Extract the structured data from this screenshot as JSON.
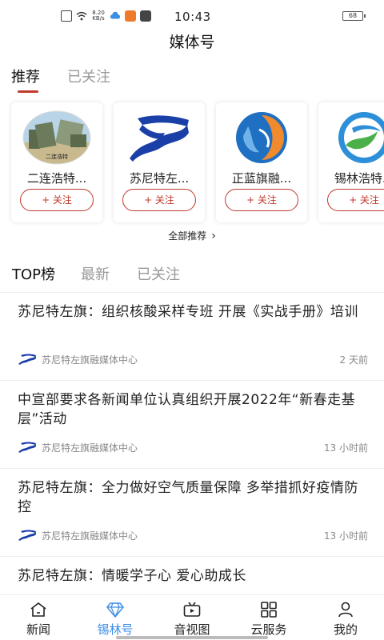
{
  "status_bar": {
    "time": "10:43",
    "battery": "68",
    "net_speed_top": "8.20",
    "net_speed_bottom": "KB/s"
  },
  "page_title": "媒体号",
  "top_tabs": [
    {
      "label": "推荐",
      "active": true
    },
    {
      "label": "已关注",
      "active": false
    }
  ],
  "media_cards": [
    {
      "name": "二连浩特...",
      "follow_label": "+ 关注",
      "logo": "erlianhaote-logo"
    },
    {
      "name": "苏尼特左...",
      "follow_label": "+ 关注",
      "logo": "sunite-logo"
    },
    {
      "name": "正蓝旗融...",
      "follow_label": "+ 关注",
      "logo": "zhenglanqi-logo"
    },
    {
      "name": "锡林浩特...",
      "follow_label": "+ 关注",
      "logo": "xilinhaote-logo"
    }
  ],
  "logo_caption": "二连浩特",
  "all_recommend": {
    "label": "全部推荐",
    "icon": "chevron-right-icon"
  },
  "list_tabs": [
    {
      "label": "TOP榜",
      "active": true
    },
    {
      "label": "最新",
      "active": false
    },
    {
      "label": "已关注",
      "active": false
    }
  ],
  "news": [
    {
      "title": "苏尼特左旗：组织核酸采样专班 开展《实战手册》培训",
      "source": "苏尼特左旗融媒体中心",
      "time": "2 天前"
    },
    {
      "title": "中宣部要求各新闻单位认真组织开展2022年“新春走基层”活动",
      "source": "苏尼特左旗融媒体中心",
      "time": "13 小时前"
    },
    {
      "title": "苏尼特左旗：全力做好空气质量保障 多举措抓好疫情防控",
      "source": "苏尼特左旗融媒体中心",
      "time": "13 小时前"
    },
    {
      "title": "苏尼特左旗：情暖学子心 爱心助成长",
      "source": "",
      "time": ""
    }
  ],
  "bottom_nav": [
    {
      "label": "新闻",
      "icon": "home-icon",
      "active": false
    },
    {
      "label": "锡林号",
      "icon": "diamond-icon",
      "active": true
    },
    {
      "label": "音视图",
      "icon": "video-icon",
      "active": false
    },
    {
      "label": "云服务",
      "icon": "grid-icon",
      "active": false
    },
    {
      "label": "我的",
      "icon": "person-icon",
      "active": false
    }
  ],
  "colors": {
    "accent": "#c0392b",
    "nav_active": "#3a8ee6",
    "brand_blue": "#1a3fa6"
  }
}
